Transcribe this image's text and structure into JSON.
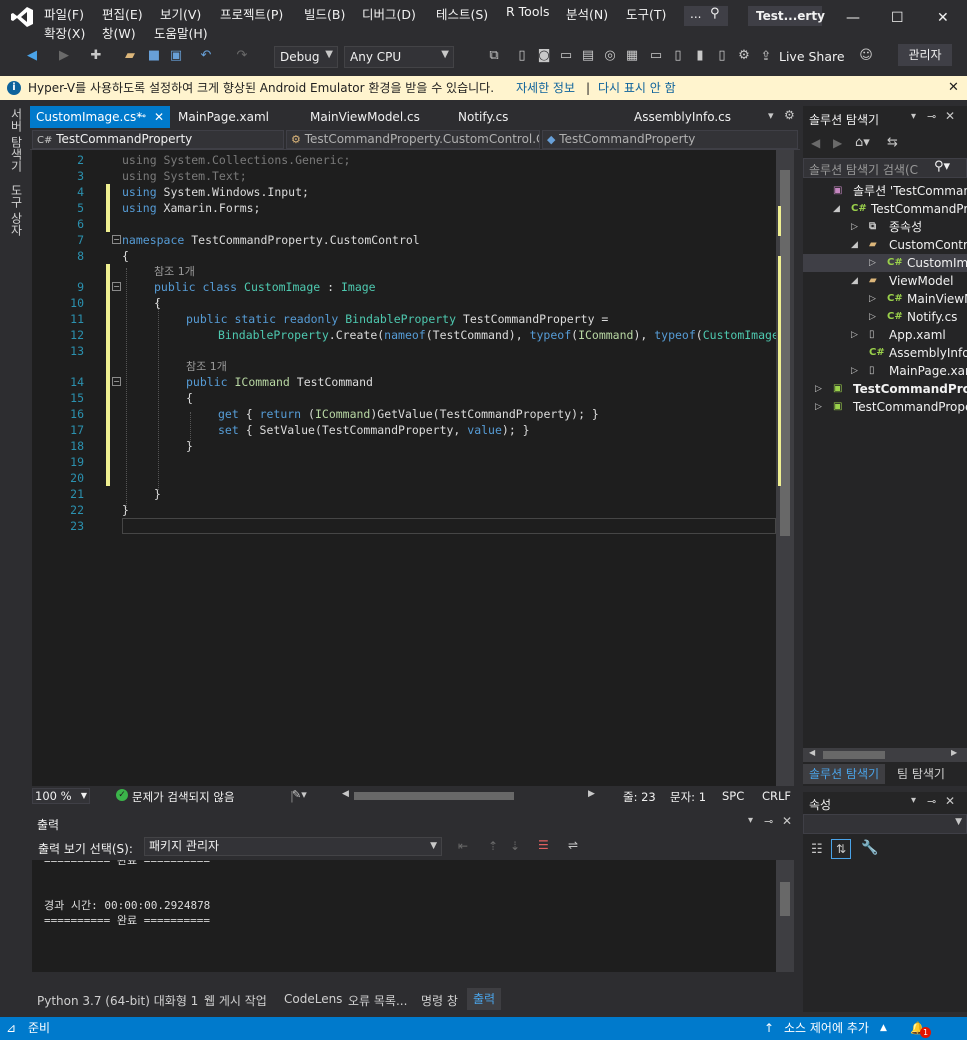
{
  "titlebar": {
    "menus_row1": [
      "파일(F)",
      "편집(E)",
      "보기(V)",
      "프로젝트(P)",
      "빌드(B)",
      "디버그(D)",
      "테스트(S)",
      "R Tools",
      "분석(N)",
      "도구(T)"
    ],
    "menus_row2": [
      "확장(X)",
      "창(W)",
      "도움말(H)"
    ],
    "search_placeholder": "...",
    "window_title": "Test...erty",
    "minimize": "—",
    "maximize": "☐",
    "close": "✕"
  },
  "toolbar": {
    "config": "Debug",
    "platform": "Any CPU",
    "live_share": "Live Share",
    "admin": "관리자"
  },
  "infobar": {
    "message": "Hyper-V를 사용하도록 설정하여 크게 향상된 Android Emulator 환경을 받을 수 있습니다.",
    "link_more": "자세한 정보",
    "separator": "|",
    "link_hide": "다시 표시 안 함",
    "close": "✕"
  },
  "left_rail": {
    "server_explorer": "서버 탐색기",
    "toolbox": "도구 상자"
  },
  "doc_tabs": [
    {
      "label": "CustomImage.cs*",
      "active": true
    },
    {
      "label": "MainPage.xaml",
      "active": false
    },
    {
      "label": "MainViewModel.cs",
      "active": false
    },
    {
      "label": "Notify.cs",
      "active": false
    },
    {
      "label": "AssemblyInfo.cs",
      "active": false
    }
  ],
  "navbar": {
    "project": "TestCommandProperty",
    "class": "TestCommandProperty.CustomControl.C",
    "member": "TestCommandProperty"
  },
  "code": {
    "line_numbers": [
      "2",
      "3",
      "4",
      "5",
      "6",
      "7",
      "8",
      "",
      "9",
      "10",
      "11",
      "12",
      "13",
      "",
      "14",
      "15",
      "16",
      "17",
      "18",
      "19",
      "20",
      "21",
      "22",
      "23"
    ],
    "ref_count": "참조 1개",
    "lines": {
      "l2a": "using",
      "l2b": " System.Collections.Generic;",
      "l3a": "using",
      "l3b": " System.Text;",
      "l4a": "using",
      "l4b": " System.Windows.Input;",
      "l5a": "using",
      "l5b": " Xamarin.Forms;",
      "l7a": "namespace",
      "l7b": " TestCommandProperty.CustomControl",
      "l8": "{",
      "l9a": "public",
      "l9b": " class",
      "l9c": " CustomImage",
      "l9d": " : ",
      "l9e": "Image",
      "l10": "{",
      "l11a": "public static readonly",
      "l11b": " BindableProperty",
      "l11c": " TestCommandProperty =",
      "l12a": "BindableProperty",
      "l12b": ".Create(",
      "l12c": "nameof",
      "l12d": "(TestCommand), ",
      "l12e": "typeof",
      "l12f": "(",
      "l12g": "ICommand",
      "l12h": "), ",
      "l12i": "typeof",
      "l12j": "(",
      "l12k": "CustomImage",
      "l14a": "public",
      "l14b": " ICommand",
      "l14c": " TestCommand",
      "l15": "{",
      "l16a": "get",
      "l16b": " { ",
      "l16c": "return",
      "l16d": " (",
      "l16e": "ICommand",
      "l16f": ")GetValue(TestCommandProperty); }",
      "l17a": "set",
      "l17b": " { SetValue(TestCommandProperty, ",
      "l17c": "value",
      "l17d": "); }",
      "l18": "}",
      "l21": "}",
      "l22": "}"
    }
  },
  "editor_status": {
    "zoom": "100 %",
    "issues": "문제가 검색되지 않음",
    "line": "줄: 23",
    "col": "문자: 1",
    "spc": "SPC",
    "crlf": "CRLF"
  },
  "output": {
    "title": "출력",
    "show_from_label": "출력 보기 선택(S):",
    "show_from_value": "패키지 관리자",
    "text_line1": "========== 완료 ==========",
    "text_line2": "",
    "text_line3": "경과 시간: 00:00:00.2924878",
    "text_line4": "========== 완료 =========="
  },
  "bottom_tabs": [
    "Python 3.7 (64-bit) 대화형 1",
    "웹 게시 작업",
    "CodeLens",
    "오류 목록...",
    "명령 창",
    "출력"
  ],
  "solution": {
    "title": "솔루션 탐색기",
    "search_placeholder": "솔루션 탐색기 검색(C",
    "items": [
      {
        "label": "솔루션 'TestCommandP",
        "indent": 0
      },
      {
        "label": "TestCommandPrope",
        "indent": 1
      },
      {
        "label": "종속성",
        "indent": 2
      },
      {
        "label": "CustomControl",
        "indent": 2
      },
      {
        "label": "CustomImag",
        "indent": 3
      },
      {
        "label": "ViewModel",
        "indent": 2
      },
      {
        "label": "MainViewMo",
        "indent": 3
      },
      {
        "label": "Notify.cs",
        "indent": 3
      },
      {
        "label": "App.xaml",
        "indent": 2
      },
      {
        "label": "AssemblyInfo.cs",
        "indent": 2
      },
      {
        "label": "MainPage.xaml",
        "indent": 2
      },
      {
        "label": "TestCommandProp",
        "indent": 0
      },
      {
        "label": "TestCommandPrope",
        "indent": 0
      }
    ],
    "tab_solution": "솔루션 탐색기",
    "tab_team": "팀 탐색기"
  },
  "properties": {
    "title": "속성"
  },
  "statusbar": {
    "ready": "준비",
    "source_control": "소스 제어에 추가",
    "notifications": "1"
  }
}
